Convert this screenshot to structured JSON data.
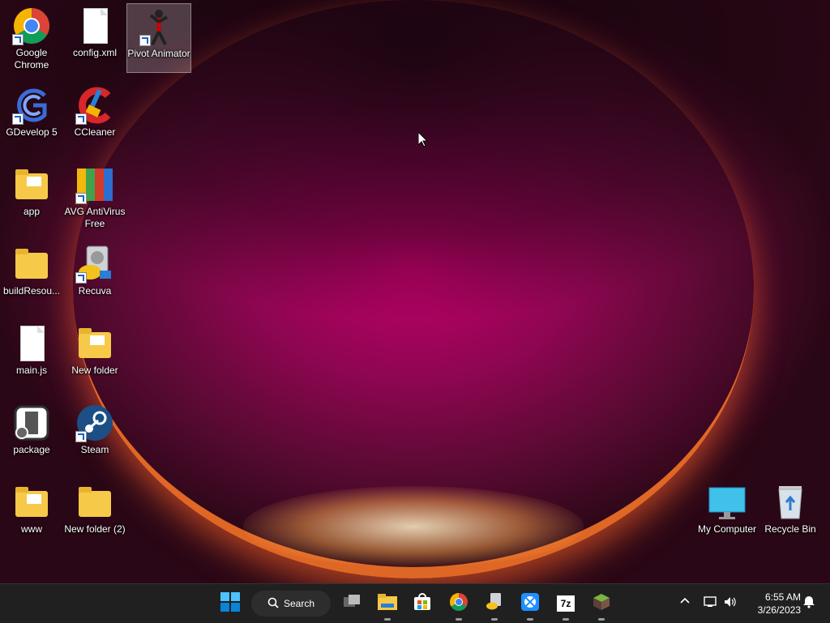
{
  "desktop_icons_left": [
    {
      "label": "Google Chrome",
      "icon": "chrome-icon"
    },
    {
      "label": "config.xml",
      "icon": "xml-file-icon"
    },
    {
      "label": "Pivot Animator",
      "icon": "pivot-animator-icon",
      "selected": true
    },
    {
      "label": "GDevelop 5",
      "icon": "gdevelop-icon"
    },
    {
      "label": "CCleaner",
      "icon": "ccleaner-icon"
    },
    {
      "label": "app",
      "icon": "folder-icon"
    },
    {
      "label": "AVG AntiVirus Free",
      "icon": "avg-icon"
    },
    {
      "label": "buildResou...",
      "icon": "folder-icon"
    },
    {
      "label": "Recuva",
      "icon": "recuva-icon"
    },
    {
      "label": "main.js",
      "icon": "js-file-icon"
    },
    {
      "label": "New folder",
      "icon": "folder-icon"
    },
    {
      "label": "package",
      "icon": "package-icon"
    },
    {
      "label": "Steam",
      "icon": "steam-icon"
    },
    {
      "label": "www",
      "icon": "folder-icon"
    },
    {
      "label": "New folder (2)",
      "icon": "folder-icon"
    }
  ],
  "desktop_icons_right": [
    {
      "label": "My Computer",
      "icon": "monitor-icon"
    },
    {
      "label": "Recycle Bin",
      "icon": "recycle-bin-icon"
    }
  ],
  "taskbar": {
    "search_label": "Search",
    "apps": [
      "start-icon",
      "task-view-icon",
      "file-explorer-icon",
      "microsoft-store-icon",
      "chrome-icon",
      "recuva-icon",
      "xbox-icon",
      "7zip-icon",
      "minecraft-icon"
    ],
    "seven_zip_text": "7z",
    "time": "6:55 AM",
    "date": "3/26/2023"
  },
  "colors": {
    "taskbar_bg": "#202020",
    "accent": "#0078d4"
  }
}
